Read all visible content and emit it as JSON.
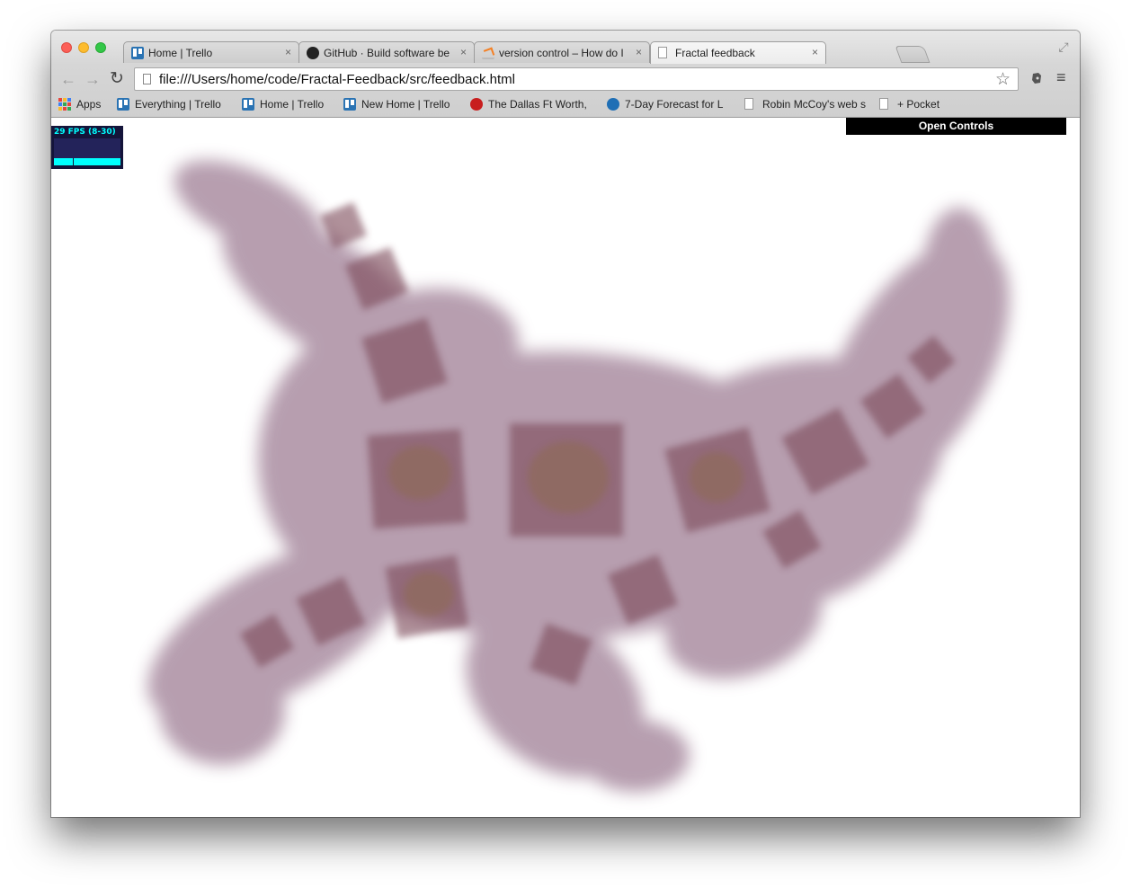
{
  "tabs": [
    {
      "title": "Home | Trello",
      "icon": "trello-icon",
      "active": false
    },
    {
      "title": "GitHub · Build software bet",
      "icon": "github-icon",
      "active": false
    },
    {
      "title": "version control – How do I",
      "icon": "stackoverflow-icon",
      "active": false
    },
    {
      "title": "Fractal feedback",
      "icon": "page-icon",
      "active": true
    }
  ],
  "tab_close_glyph": "×",
  "toolbar": {
    "url": "file:///Users/home/code/Fractal-Feedback/src/feedback.html"
  },
  "bookmarks": [
    {
      "label": "Apps",
      "icon": "apps-grid-icon"
    },
    {
      "label": "Everything | Trello",
      "icon": "trello-icon"
    },
    {
      "label": "Home | Trello",
      "icon": "trello-icon"
    },
    {
      "label": "New Home | Trello",
      "icon": "trello-icon"
    },
    {
      "label": "The Dallas Ft Worth,",
      "icon": "dallas-icon"
    },
    {
      "label": "7-Day Forecast for L",
      "icon": "noaa-icon"
    },
    {
      "label": "Robin McCoy's web s",
      "icon": "page-icon"
    },
    {
      "label": "+ Pocket",
      "icon": "page-icon"
    }
  ],
  "stats": {
    "fps_text": "29 FPS (8-30)"
  },
  "controls": {
    "open_label": "Open Controls"
  },
  "colors": {
    "fractal_purple": "#7b4f6e",
    "fractal_gold": "#8a6a3a",
    "fps_cyan": "#00ffff",
    "fps_bg": "#14143a"
  }
}
